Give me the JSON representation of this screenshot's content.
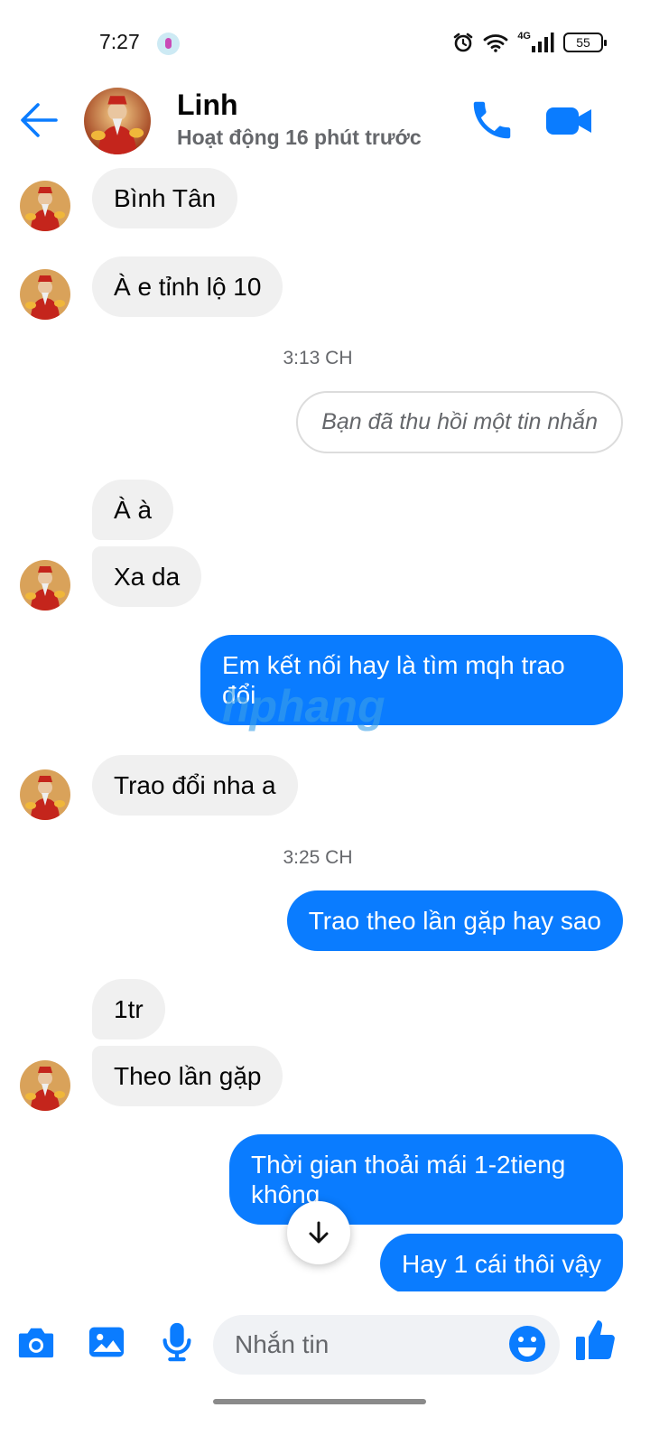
{
  "status_bar": {
    "time": "7:27",
    "network": "4G",
    "battery": "55"
  },
  "header": {
    "contact_name": "Linh",
    "contact_status": "Hoạt động 16 phút trước"
  },
  "messages": [
    {
      "from": "them",
      "text": "Bình Tân"
    },
    {
      "from": "them",
      "text": "À e tỉnh lộ 10"
    },
    {
      "type": "timestamp",
      "text": "3:13 CH"
    },
    {
      "from": "me",
      "type": "unsent",
      "text": "Bạn đã thu hồi một tin nhắn"
    },
    {
      "from": "them",
      "text": "À à"
    },
    {
      "from": "them",
      "text": "Xa da"
    },
    {
      "from": "me",
      "text": "Em kết nối hay là tìm mqh trao đổi"
    },
    {
      "from": "them",
      "text": "Trao đổi nha a"
    },
    {
      "type": "timestamp",
      "text": "3:25 CH"
    },
    {
      "from": "me",
      "text": "Trao theo lần gặp hay sao"
    },
    {
      "from": "them",
      "text": "1tr"
    },
    {
      "from": "them",
      "text": "Theo lần gặp"
    },
    {
      "from": "me",
      "text": "Thời gian thoải mái 1-2tieng không"
    },
    {
      "from": "me",
      "text": "Hay 1 cái thôi vậy"
    }
  ],
  "watermark": {
    "text": "hphang"
  },
  "composer": {
    "placeholder": "Nhắn tin"
  },
  "colors": {
    "accent": "#0a7cff",
    "incoming_bubble": "#f0f0f0",
    "secondary_text": "#65676b"
  },
  "icons": {
    "header": [
      "back-arrow-icon",
      "phone-icon",
      "video-camera-icon"
    ],
    "composer": [
      "camera-icon",
      "image-icon",
      "microphone-icon",
      "emoji-icon",
      "thumbs-up-icon"
    ],
    "scroll": "arrow-down-icon"
  }
}
